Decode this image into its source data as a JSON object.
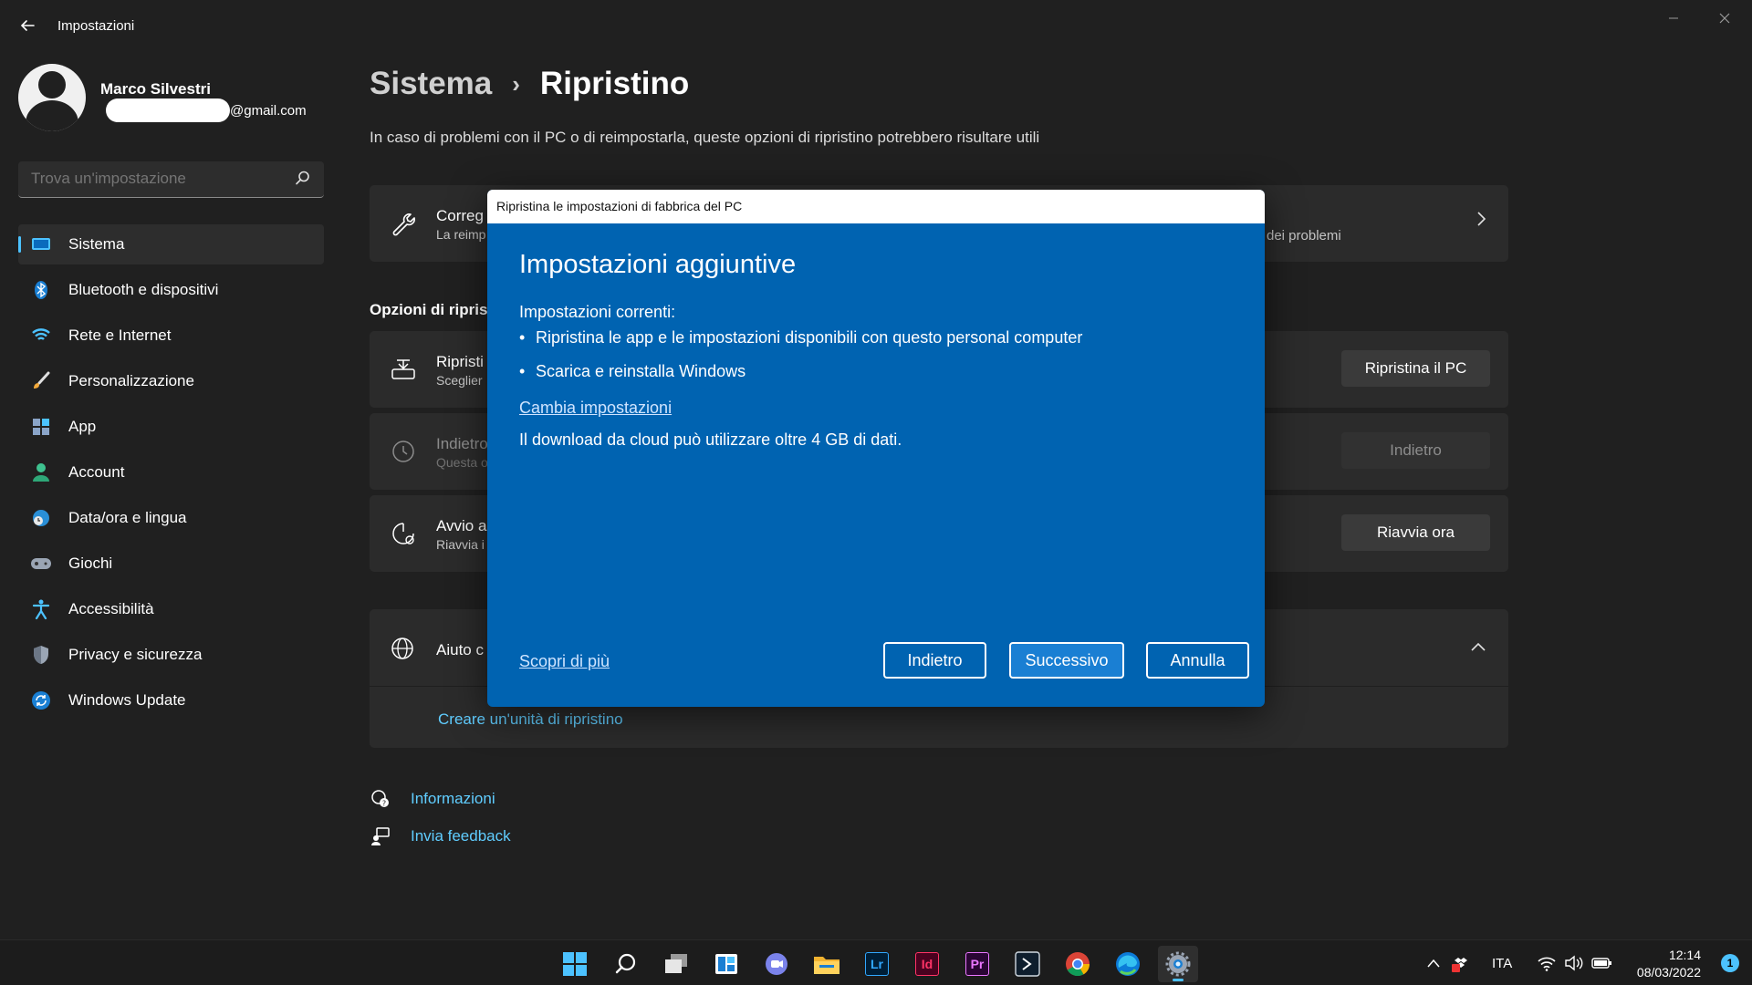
{
  "window": {
    "title": "Impostazioni",
    "back_icon": "back-arrow-icon",
    "controls": [
      "minimize-icon",
      "maximize-icon",
      "close-icon"
    ]
  },
  "profile": {
    "name": "Marco Silvestri",
    "email_suffix": "@gmail.com"
  },
  "search": {
    "placeholder": "Trova un'impostazione",
    "icon": "search-icon"
  },
  "sidebar": {
    "items": [
      {
        "label": "Sistema",
        "icon": "system-icon",
        "active": true
      },
      {
        "label": "Bluetooth e dispositivi",
        "icon": "bluetooth-icon"
      },
      {
        "label": "Rete e Internet",
        "icon": "wifi-icon"
      },
      {
        "label": "Personalizzazione",
        "icon": "brush-icon"
      },
      {
        "label": "App",
        "icon": "apps-icon"
      },
      {
        "label": "Account",
        "icon": "account-icon"
      },
      {
        "label": "Data/ora e lingua",
        "icon": "globe-clock-icon"
      },
      {
        "label": "Giochi",
        "icon": "gamepad-icon"
      },
      {
        "label": "Accessibilità",
        "icon": "accessibility-icon"
      },
      {
        "label": "Privacy e sicurezza",
        "icon": "shield-icon"
      },
      {
        "label": "Windows Update",
        "icon": "update-icon"
      }
    ]
  },
  "breadcrumb": {
    "parent": "Sistema",
    "separator": "›",
    "current": "Ripristino"
  },
  "page": {
    "subtitle": "In caso di problemi con il PC o di reimpostarla, queste opzioni di ripristino potrebbero risultare utili",
    "troubleshoot": {
      "title": "Correg",
      "desc": "La reimp",
      "desc_right": "dei problemi",
      "icon": "wrench-icon"
    },
    "section_title": "Opzioni di ripristi",
    "options": [
      {
        "title": "Ripristi",
        "desc": "Sceglier",
        "button": "Ripristina il PC",
        "icon": "reset-pc-icon",
        "disabled": false
      },
      {
        "title": "Indietro",
        "desc": "Questa o",
        "button": "Indietro",
        "icon": "history-icon",
        "disabled": true
      },
      {
        "title": "Avvio a",
        "desc": "Riavvia i",
        "button": "Riavvia ora",
        "icon": "advanced-startup-icon",
        "disabled": false
      }
    ],
    "help": {
      "title": "Aiuto c",
      "link": "Creare un'unità di ripristino",
      "icon": "globe-help-icon"
    },
    "footer_links": [
      {
        "label": "Informazioni",
        "icon": "help-chat-icon"
      },
      {
        "label": "Invia feedback",
        "icon": "feedback-icon"
      }
    ]
  },
  "dialog": {
    "title": "Ripristina le impostazioni di fabbrica del PC",
    "heading": "Impostazioni aggiuntive",
    "current_label": "Impostazioni correnti:",
    "bullets": [
      "Ripristina le app e le impostazioni disponibili con questo personal computer",
      "Scarica e reinstalla Windows"
    ],
    "change_link": "Cambia impostazioni",
    "note": "Il download da cloud può utilizzare oltre 4 GB di dati.",
    "learn_more": "Scopri di più",
    "buttons": {
      "back": "Indietro",
      "next": "Successivo",
      "cancel": "Annulla"
    }
  },
  "taskbar": {
    "apps": [
      {
        "name": "start",
        "icon": "windows-logo-icon"
      },
      {
        "name": "search",
        "icon": "search-icon"
      },
      {
        "name": "task-view",
        "icon": "task-view-icon"
      },
      {
        "name": "widgets",
        "icon": "widgets-icon"
      },
      {
        "name": "chat",
        "icon": "chat-icon"
      },
      {
        "name": "file-explorer",
        "icon": "folder-icon"
      },
      {
        "name": "lightroom",
        "label": "Lr",
        "icon": "lightroom-icon",
        "color": "#31a8ff",
        "bg": "#001e36"
      },
      {
        "name": "indesign",
        "label": "Id",
        "icon": "indesign-icon",
        "color": "#ff3366",
        "bg": "#49021f"
      },
      {
        "name": "premiere",
        "label": "Pr",
        "icon": "premiere-icon",
        "color": "#ea77ff",
        "bg": "#2a0634"
      },
      {
        "name": "app-dark",
        "icon": "app-dark-icon"
      },
      {
        "name": "chrome",
        "icon": "chrome-icon"
      },
      {
        "name": "edge",
        "icon": "edge-icon"
      },
      {
        "name": "settings",
        "icon": "settings-gear-icon",
        "active": true
      }
    ],
    "tray": {
      "language": "ITA",
      "time": "12:14",
      "date": "08/03/2022",
      "notifications": "1"
    }
  },
  "colors": {
    "background": "#202020",
    "card": "#2b2b2b",
    "accent": "#4cc2ff",
    "link": "#60cdff",
    "dialog_bg": "#0063b1"
  }
}
